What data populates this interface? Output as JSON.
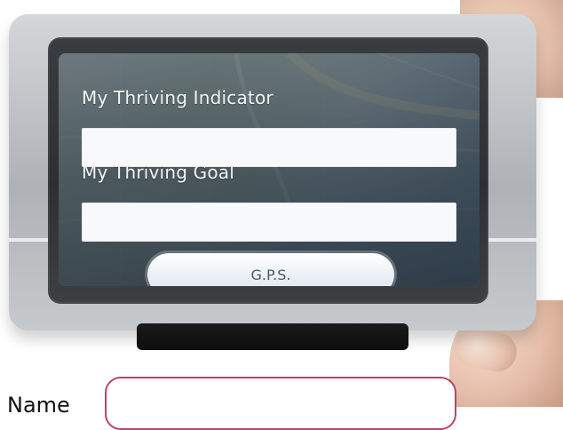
{
  "screen": {
    "fields": [
      {
        "label": "My Thriving Indicator",
        "value": ""
      },
      {
        "label": "My Thriving Goal",
        "value": ""
      }
    ],
    "button_label": "G.P.S."
  },
  "form": {
    "name_label": "Name",
    "name_value": ""
  },
  "colors": {
    "name_input_border": "#b7446a",
    "screen_overlay": "#2f4456"
  }
}
